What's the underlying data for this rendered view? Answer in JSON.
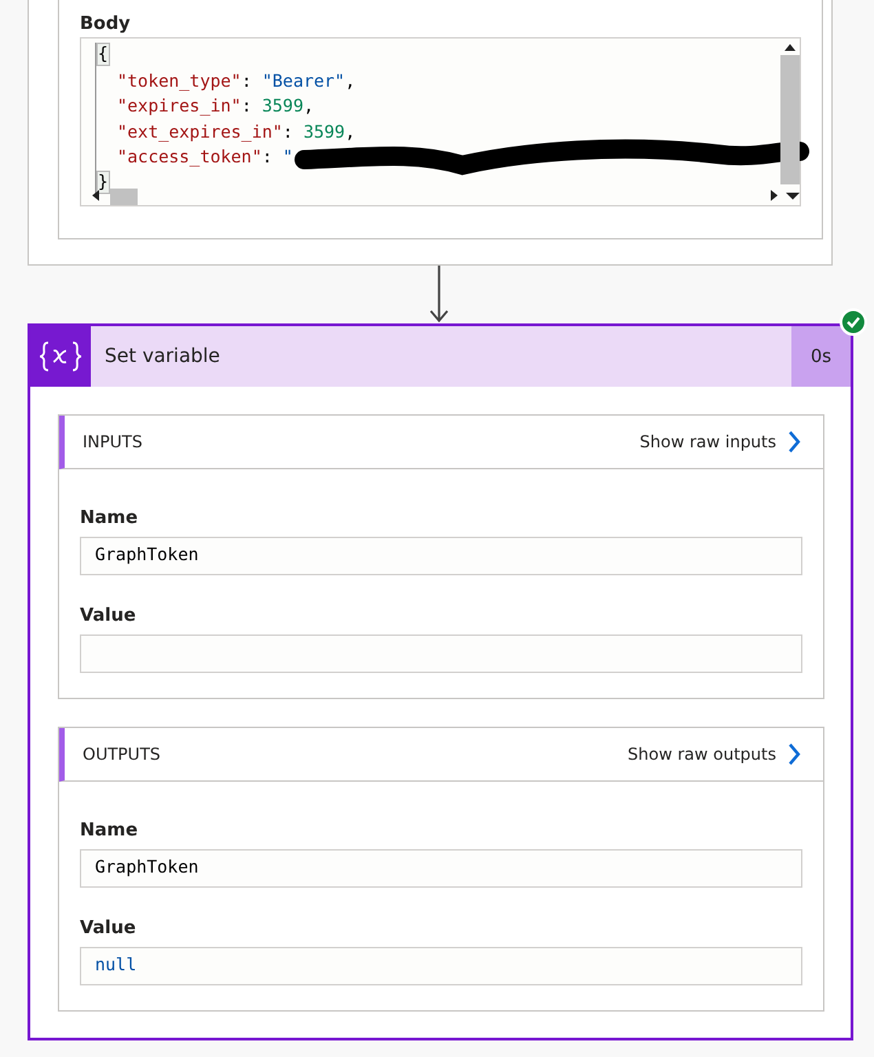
{
  "body_panel": {
    "label": "Body",
    "code_lines": [
      {
        "indent": false,
        "redacted": false,
        "tokens": [
          {
            "kind": "brace",
            "text": "{"
          }
        ]
      },
      {
        "indent": true,
        "redacted": false,
        "tokens": [
          {
            "kind": "key",
            "text": "\"token_type\""
          },
          {
            "kind": "punct",
            "text": ": "
          },
          {
            "kind": "string",
            "text": "\"Bearer\""
          },
          {
            "kind": "punct",
            "text": ","
          }
        ]
      },
      {
        "indent": true,
        "redacted": false,
        "tokens": [
          {
            "kind": "key",
            "text": "\"expires_in\""
          },
          {
            "kind": "punct",
            "text": ": "
          },
          {
            "kind": "number",
            "text": "3599"
          },
          {
            "kind": "punct",
            "text": ","
          }
        ]
      },
      {
        "indent": true,
        "redacted": false,
        "tokens": [
          {
            "kind": "key",
            "text": "\"ext_expires_in\""
          },
          {
            "kind": "punct",
            "text": ": "
          },
          {
            "kind": "number",
            "text": "3599"
          },
          {
            "kind": "punct",
            "text": ","
          }
        ]
      },
      {
        "indent": true,
        "redacted": true,
        "tokens": [
          {
            "kind": "key",
            "text": "\"access_token\""
          },
          {
            "kind": "punct",
            "text": ": "
          },
          {
            "kind": "string",
            "text": "\""
          }
        ]
      },
      {
        "indent": false,
        "redacted": false,
        "tokens": [
          {
            "kind": "brace",
            "text": "}"
          }
        ]
      }
    ]
  },
  "step": {
    "title": "Set variable",
    "duration": "0s",
    "succeeded": true,
    "sections": [
      {
        "title": "INPUTS",
        "link": "Show raw inputs",
        "fields": [
          {
            "label": "Name",
            "kind": "text",
            "value": "GraphToken"
          },
          {
            "label": "Value",
            "kind": "text"
          }
        ]
      },
      {
        "title": "OUTPUTS",
        "link": "Show raw outputs",
        "fields": [
          {
            "label": "Name",
            "kind": "text",
            "value": "GraphToken"
          },
          {
            "label": "Value",
            "kind": "literal",
            "value": "null"
          }
        ]
      }
    ]
  }
}
